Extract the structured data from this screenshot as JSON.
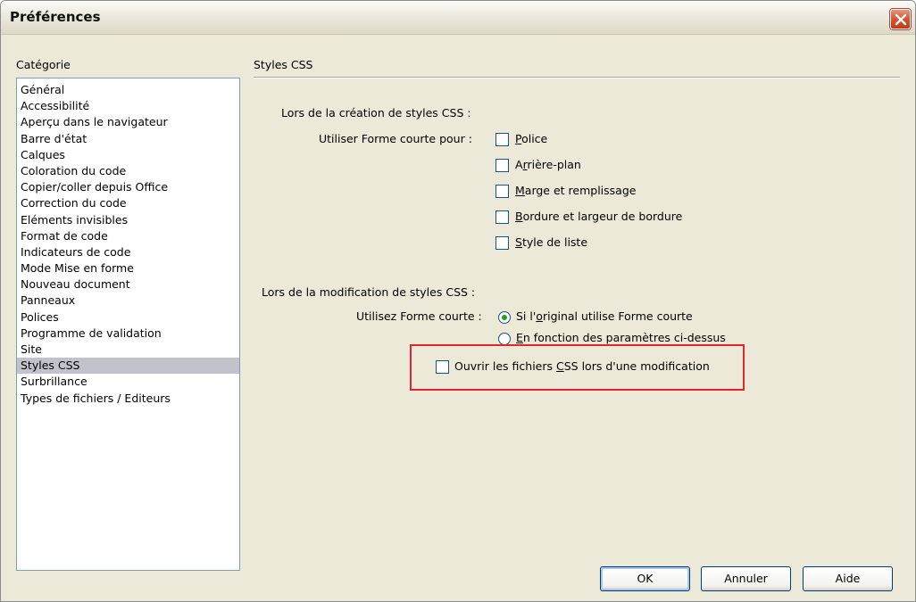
{
  "window": {
    "title": "Préférences"
  },
  "categories": {
    "label": "Catégorie",
    "items": [
      "Général",
      "Accessibilité",
      "Aperçu dans le navigateur",
      "Barre d'état",
      "Calques",
      "Coloration du code",
      "Copier/coller depuis Office",
      "Correction du code",
      "Eléments invisibles",
      "Format de code",
      "Indicateurs de code",
      "Mode Mise en forme",
      "Nouveau document",
      "Panneaux",
      "Polices",
      "Programme de validation",
      "Site",
      "Styles CSS",
      "Surbrillance",
      "Types de fichiers / Editeurs"
    ],
    "selected": "Styles CSS"
  },
  "panel": {
    "title": "Styles CSS",
    "creation": {
      "heading": "Lors de la création de styles CSS :",
      "label": "Utiliser Forme courte pour :",
      "options": [
        {
          "pre": "",
          "accel": "P",
          "post": "olice",
          "checked": false
        },
        {
          "pre": "A",
          "accel": "r",
          "post": "rière-plan",
          "checked": false
        },
        {
          "pre": "",
          "accel": "M",
          "post": "arge et remplissage",
          "checked": false
        },
        {
          "pre": "",
          "accel": "B",
          "post": "ordure et largeur de bordure",
          "checked": false
        },
        {
          "pre": "",
          "accel": "S",
          "post": "tyle de liste",
          "checked": false
        }
      ]
    },
    "modification": {
      "heading": "Lors de la modification de styles CSS :",
      "label": "Utilisez Forme courte :",
      "radios": [
        {
          "pre": "Si l'",
          "accel": "o",
          "post": "riginal utilise Forme courte",
          "selected": true
        },
        {
          "pre": "",
          "accel": "E",
          "post": "n fonction des paramètres ci-dessus",
          "selected": false
        }
      ],
      "open_css": {
        "pre": "Ouvrir les fichiers ",
        "accel": "C",
        "post": "SS lors d'une modification",
        "checked": false
      }
    }
  },
  "buttons": {
    "ok": "OK",
    "cancel": "Annuler",
    "help": "Aide"
  }
}
